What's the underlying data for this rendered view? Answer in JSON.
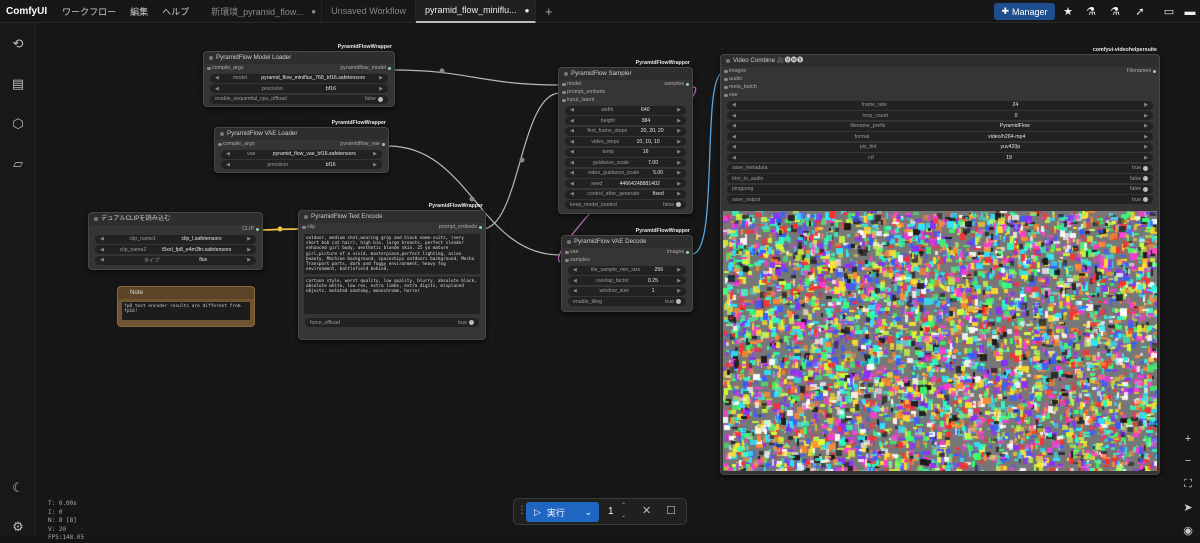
{
  "app": {
    "brand": "ComfyUI",
    "menus": [
      "ワークフロー",
      "編集",
      "ヘルプ"
    ]
  },
  "tabs": [
    {
      "label": "新環境_pyramid_flow...",
      "dot": "●"
    },
    {
      "label": "Unsaved Workflow",
      "dot": ""
    },
    {
      "label": "pyramid_flow_miniflu...",
      "dot": "●"
    }
  ],
  "toolbar": {
    "manager": "Manager"
  },
  "icons": {
    "sidebar": [
      "history-icon",
      "node-library-icon",
      "model-library-icon",
      "workflows-icon",
      "theme-moon-icon",
      "settings-gear-icon"
    ],
    "right": [
      "zoom-in-icon",
      "zoom-out-icon",
      "fit-view-icon",
      "select-mode-icon",
      "toggle-link-visibility-icon"
    ]
  },
  "nodes": {
    "model_loader": {
      "title": "PyramidFlow Model Loader",
      "badge": "PyramidFlowWrapper",
      "inputs": [
        "compile_args"
      ],
      "outputs": [
        "pyramidflow_model"
      ],
      "widgets": [
        {
          "name": "model",
          "value": "pyramid_flow_miniflux_768_bf16.safetensors"
        },
        {
          "name": "precision",
          "value": "bf16"
        },
        {
          "name": "enable_sequential_cpu_offload",
          "value": "false"
        }
      ]
    },
    "vae_loader": {
      "title": "PyramidFlow VAE Loader",
      "badge": "PyramidFlowWrapper",
      "inputs": [
        "compile_args"
      ],
      "outputs": [
        "pyramidflow_vae"
      ],
      "widgets": [
        {
          "name": "vae",
          "value": "pyramid_flow_vae_bf16.safetensors"
        },
        {
          "name": "precision",
          "value": "bf16"
        }
      ]
    },
    "dual_clip": {
      "title": "デュアルCLIPを読み込む",
      "outputs": [
        "CLIP"
      ],
      "widgets": [
        {
          "name": "clip_name1",
          "value": "clip_l.safetensors"
        },
        {
          "name": "clip_name2",
          "value": "t5xxl_fp8_e4m3fn.safetensors"
        },
        {
          "name": "タイプ",
          "value": "flux"
        }
      ]
    },
    "note": {
      "title": "Note",
      "text": "fp8 text encoder results are different from fp16!"
    },
    "text_encode": {
      "title": "PyramidFlow Text Encode",
      "badge": "PyramidFlowWrapper",
      "inputs": [
        "clip"
      ],
      "outputs": [
        "prompt_embeds"
      ],
      "positive": "outdoor, medium shot,wearing gray and black name-suits, (very short bob cut hair), high bio, large breasts, perfect slender enhanced girl body, aesthetic blonde skin, 25 yo mature girl,picture of a vivid, masterpiece,perfect lighting, asian beauty, Machine background, spaceships outdoors background, Mecha Transport ports, dark and foggy environment, heavy fog environment, battlefield behind,",
      "negative": "cartoon style, worst quality, low quality, blurry, absolute black, absolute white, low res, extra limbs, extra digits, misplaced objects, mutated anatomy, monochrome, horror",
      "widgets": [
        {
          "name": "force_offload",
          "value": "true"
        }
      ]
    },
    "sampler": {
      "title": "PyramidFlow Sampler",
      "badge": "PyramidFlowWrapper",
      "inputs": [
        "model",
        "prompt_embeds",
        "input_latent"
      ],
      "outputs": [
        "samples"
      ],
      "widgets": [
        {
          "name": "width",
          "value": "640"
        },
        {
          "name": "height",
          "value": "384"
        },
        {
          "name": "first_frame_steps",
          "value": "20, 20, 20"
        },
        {
          "name": "video_steps",
          "value": "10, 10, 10"
        },
        {
          "name": "temp",
          "value": "16"
        },
        {
          "name": "guidance_scale",
          "value": "7.00"
        },
        {
          "name": "video_guidance_scale",
          "value": "5.00"
        },
        {
          "name": "seed",
          "value": "44664248881402"
        },
        {
          "name": "control_after_generate",
          "value": "fixed"
        },
        {
          "name": "keep_model_loaded",
          "value": "false"
        }
      ]
    },
    "vae_decode": {
      "title": "PyramidFlow VAE Decode",
      "badge": "PyramidFlowWrapper",
      "inputs": [
        "vae",
        "samples"
      ],
      "outputs": [
        "images"
      ],
      "widgets": [
        {
          "name": "tile_sample_min_size",
          "value": "256"
        },
        {
          "name": "overlap_factor",
          "value": "0.25"
        },
        {
          "name": "window_size",
          "value": "1"
        },
        {
          "name": "enable_tiling",
          "value": "true"
        }
      ]
    },
    "video_combine": {
      "title": "Video Combine 🎥🅥🅗🅢",
      "badge": "comfyui-videohelpersuite",
      "inputs": [
        "images",
        "audio",
        "meta_batch",
        "vae"
      ],
      "outputs": [
        "Filenames"
      ],
      "widgets": [
        {
          "name": "frame_rate",
          "value": "24"
        },
        {
          "name": "loop_count",
          "value": "0"
        },
        {
          "name": "filename_prefix",
          "value": "PyramidFlow"
        },
        {
          "name": "format",
          "value": "video/h264-mp4"
        },
        {
          "name": "pix_fmt",
          "value": "yuv420p"
        },
        {
          "name": "crf",
          "value": "19"
        },
        {
          "name": "save_metadata",
          "value": "true"
        },
        {
          "name": "trim_to_audio",
          "value": "false"
        },
        {
          "name": "pingpong",
          "value": "false"
        },
        {
          "name": "save_output",
          "value": "true"
        }
      ]
    }
  },
  "stats": [
    "T: 0.00s",
    "I: 0",
    "N: 8 [8]",
    "V: 20",
    "FPS:148.05"
  ],
  "runbar": {
    "run_label": "実行",
    "count": "1"
  }
}
